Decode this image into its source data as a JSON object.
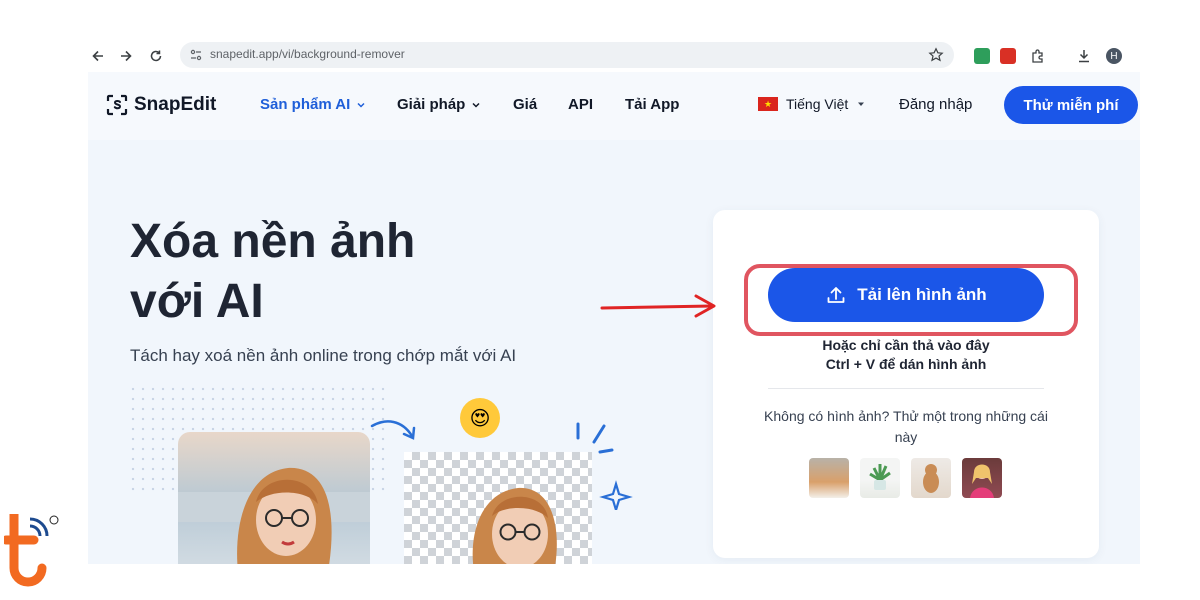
{
  "browser": {
    "url": "snapedit.app/vi/background-remover",
    "avatar_initial": "H"
  },
  "header": {
    "logo_text": "SnapEdit",
    "nav": [
      {
        "label": "Sản phẩm AI",
        "has_dropdown": true,
        "active": true
      },
      {
        "label": "Giải pháp",
        "has_dropdown": true,
        "active": false
      },
      {
        "label": "Giá",
        "has_dropdown": false,
        "active": false
      },
      {
        "label": "API",
        "has_dropdown": false,
        "active": false
      },
      {
        "label": "Tải App",
        "has_dropdown": false,
        "active": false
      }
    ],
    "language": "Tiếng Việt",
    "login": "Đăng nhập",
    "cta": "Thử miễn phí"
  },
  "hero": {
    "title_line1": "Xóa nền ảnh",
    "title_line2": "với AI",
    "subtitle": "Tách hay xoá nền ảnh online trong chớp mắt với AI"
  },
  "upload": {
    "button_label": "Tải lên hình ảnh",
    "drop_hint": "Hoặc chỉ cần thả vào đây",
    "paste_hint": "Ctrl + V để dán hình ảnh",
    "samples_label": "Không có hình ảnh? Thử một trong những cái này",
    "samples": [
      "cat-sample",
      "plant-sample",
      "dog-sample",
      "person-sample"
    ]
  },
  "colors": {
    "accent": "#1b56e8",
    "highlight_border": "#e05560",
    "underline": "#4ee6ea",
    "arrow": "#e02424"
  }
}
